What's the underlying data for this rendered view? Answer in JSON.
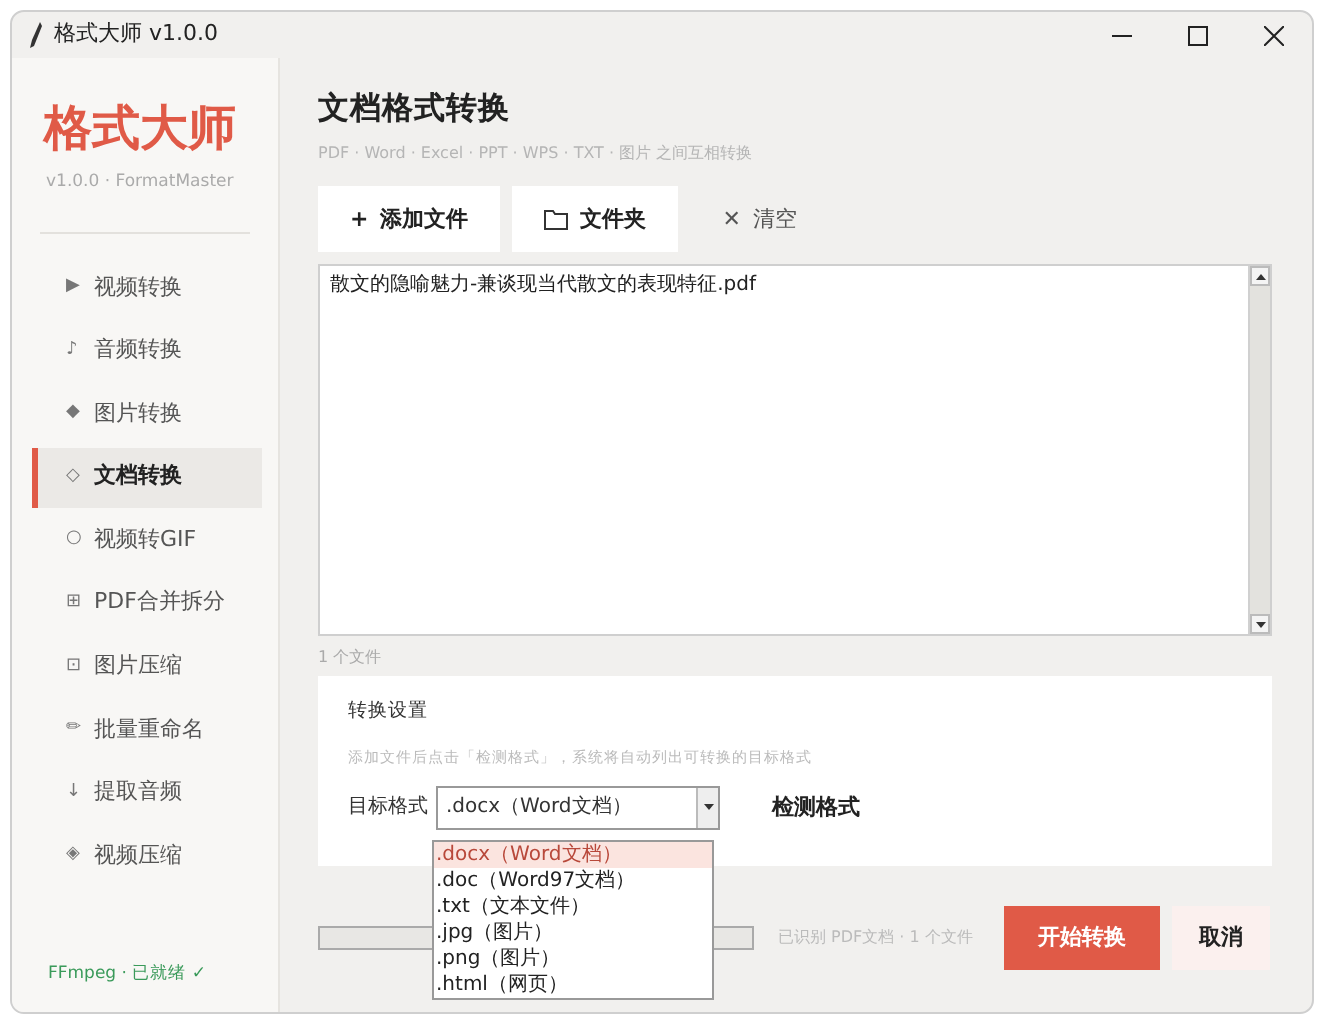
{
  "window": {
    "title": "格式大师 v1.0.0"
  },
  "sidebar": {
    "logo": "格式大师",
    "version": "v1.0.0 · FormatMaster",
    "items": [
      {
        "icon": "▶",
        "label": "视频转换",
        "selected": false
      },
      {
        "icon": "♪",
        "label": "音频转换",
        "selected": false
      },
      {
        "icon": "◆",
        "label": "图片转换",
        "selected": false
      },
      {
        "icon": "◇",
        "label": "文档转换",
        "selected": true
      },
      {
        "icon": "○",
        "label": "视频转GIF",
        "selected": false
      },
      {
        "icon": "⊞",
        "label": "PDF合并拆分",
        "selected": false
      },
      {
        "icon": "⊡",
        "label": "图片压缩",
        "selected": false
      },
      {
        "icon": "✏",
        "label": "批量重命名",
        "selected": false
      },
      {
        "icon": "↓",
        "label": "提取音频",
        "selected": false
      },
      {
        "icon": "◈",
        "label": "视频压缩",
        "selected": false
      }
    ],
    "status": "FFmpeg · 已就绪 ✓"
  },
  "main": {
    "title": "文档格式转换",
    "subtitle": "PDF · Word · Excel · PPT · WPS · TXT · 图片 之间互相转换",
    "toolbar": [
      {
        "kind": "add",
        "icon": "+",
        "label": "添加文件"
      },
      {
        "kind": "folder",
        "label": "文件夹"
      },
      {
        "kind": "clear",
        "icon": "✕",
        "label": "清空"
      }
    ],
    "files": [
      "散文的隐喻魅力-兼谈现当代散文的表现特征.pdf"
    ],
    "file_count": "1 个文件",
    "settings": {
      "title": "转换设置",
      "hint": "添加文件后点击「检测格式」，系统将自动列出可转换的目标格式",
      "format_label": "目标格式",
      "format_value": ".docx（Word文档）",
      "detect_button": "检测格式",
      "options": [
        {
          "label": ".docx（Word文档）",
          "selected": true
        },
        {
          "label": ".doc（Word97文档）",
          "selected": false
        },
        {
          "label": ".txt（文本文件）",
          "selected": false
        },
        {
          "label": ".jpg（图片）",
          "selected": false
        },
        {
          "label": ".png（图片）",
          "selected": false
        },
        {
          "label": ".html（网页）",
          "selected": false
        }
      ]
    },
    "progress": {
      "level": 0
    },
    "status": "已识别 PDF文档 · 1 个文件",
    "start_button": "开始转换",
    "cancel_button": "取消"
  }
}
